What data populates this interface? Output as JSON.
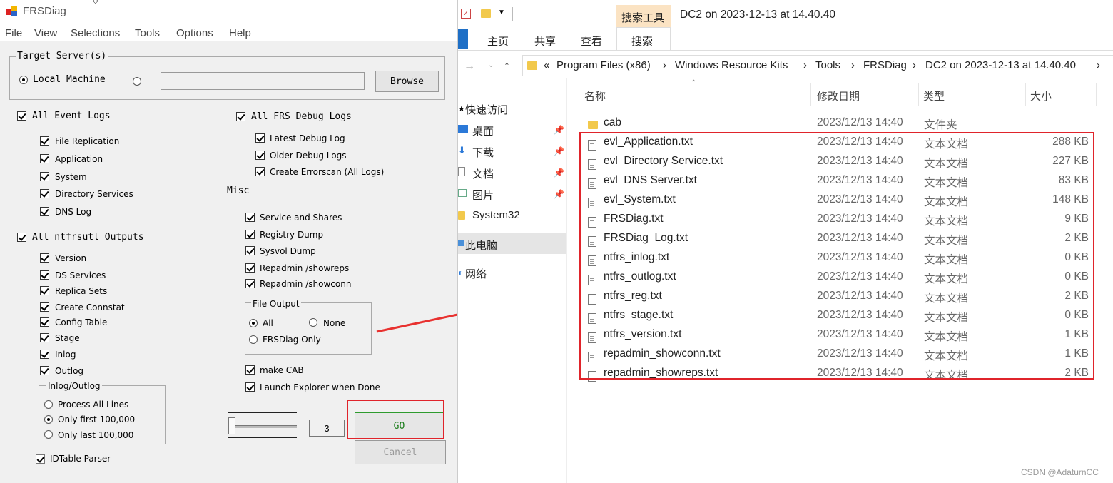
{
  "frsdiag": {
    "title": "FRSDiag",
    "menu": [
      "File",
      "View",
      "Selections",
      "Tools",
      "Options",
      "Help"
    ],
    "target_server": {
      "group_title": "Target Server(s)",
      "local_machine": "Local Machine",
      "server_input_value": "",
      "browse": "Browse"
    },
    "event_logs": {
      "all": "All Event Logs",
      "items": [
        "File Replication",
        "Application",
        "System",
        "Directory Services",
        "DNS Log"
      ]
    },
    "ntfrsutl": {
      "all": "All ntfrsutl Outputs",
      "items": [
        "Version",
        "DS Services",
        "Replica Sets",
        "Create Connstat",
        "Config Table",
        "Stage",
        "Inlog",
        "Outlog"
      ]
    },
    "inlog_outlog": {
      "title": "Inlog/Outlog",
      "options": [
        "Process All Lines",
        "Only first 100,000",
        "Only last 100,000"
      ]
    },
    "idtable": "IDTable Parser",
    "frs_debug": {
      "all": "All FRS Debug Logs",
      "items": [
        "Latest Debug Log",
        "Older Debug Logs",
        "Create Errorscan (All Logs)"
      ]
    },
    "misc": {
      "title": "Misc",
      "items": [
        "Service and Shares",
        "Registry Dump",
        "Sysvol Dump",
        "Repadmin /showreps",
        "Repadmin /showconn"
      ]
    },
    "file_output": {
      "title": "File Output",
      "all": "All",
      "none": "None",
      "frsdiag_only": "FRSDiag Only"
    },
    "make_cab": "make CAB",
    "launch_explorer": "Launch Explorer when Done",
    "slider_value": "3",
    "go": "GO",
    "cancel": "Cancel"
  },
  "explorer": {
    "ribbon_context": "搜索工具",
    "window_title": "DC2 on 2023-12-13 at 14.40.40",
    "tabs": [
      "主页",
      "共享",
      "查看",
      "搜索"
    ],
    "breadcrumb": [
      "«",
      "Program Files (x86)",
      "Windows Resource Kits",
      "Tools",
      "FRSDiag",
      "DC2 on 2023-12-13 at 14.40.40"
    ],
    "nav": [
      "快速访问",
      "桌面",
      "下载",
      "文档",
      "图片",
      "System32",
      "此电脑",
      "网络"
    ],
    "columns": [
      "名称",
      "修改日期",
      "类型",
      "大小"
    ],
    "files": [
      {
        "name": "cab",
        "date": "2023/12/13 14:40",
        "type": "文件夹",
        "size": ""
      },
      {
        "name": "evl_Application.txt",
        "date": "2023/12/13 14:40",
        "type": "文本文档",
        "size": "288 KB"
      },
      {
        "name": "evl_Directory Service.txt",
        "date": "2023/12/13 14:40",
        "type": "文本文档",
        "size": "227 KB"
      },
      {
        "name": "evl_DNS Server.txt",
        "date": "2023/12/13 14:40",
        "type": "文本文档",
        "size": "83 KB"
      },
      {
        "name": "evl_System.txt",
        "date": "2023/12/13 14:40",
        "type": "文本文档",
        "size": "148 KB"
      },
      {
        "name": "FRSDiag.txt",
        "date": "2023/12/13 14:40",
        "type": "文本文档",
        "size": "9 KB"
      },
      {
        "name": "FRSDiag_Log.txt",
        "date": "2023/12/13 14:40",
        "type": "文本文档",
        "size": "2 KB"
      },
      {
        "name": "ntfrs_inlog.txt",
        "date": "2023/12/13 14:40",
        "type": "文本文档",
        "size": "0 KB"
      },
      {
        "name": "ntfrs_outlog.txt",
        "date": "2023/12/13 14:40",
        "type": "文本文档",
        "size": "0 KB"
      },
      {
        "name": "ntfrs_reg.txt",
        "date": "2023/12/13 14:40",
        "type": "文本文档",
        "size": "2 KB"
      },
      {
        "name": "ntfrs_stage.txt",
        "date": "2023/12/13 14:40",
        "type": "文本文档",
        "size": "0 KB"
      },
      {
        "name": "ntfrs_version.txt",
        "date": "2023/12/13 14:40",
        "type": "文本文档",
        "size": "1 KB"
      },
      {
        "name": "repadmin_showconn.txt",
        "date": "2023/12/13 14:40",
        "type": "文本文档",
        "size": "1 KB"
      },
      {
        "name": "repadmin_showreps.txt",
        "date": "2023/12/13 14:40",
        "type": "文本文档",
        "size": "2 KB"
      }
    ]
  },
  "watermark": "CSDN @AdaturnCC",
  "colors": {
    "highlight_red": "#e0242b",
    "arrow_red": "#e8312f",
    "go_border": "#2e9b2e",
    "ribbon_context_bg": "#fbe3c3"
  }
}
